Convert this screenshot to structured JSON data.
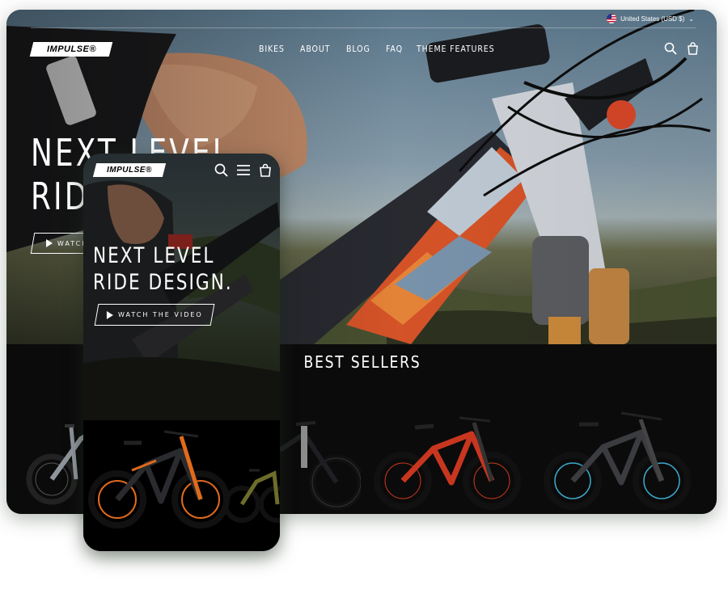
{
  "desktop": {
    "currency": "United States (USD $)",
    "logo": "IMPULSE®",
    "nav": [
      "BIKES",
      "ABOUT",
      "BLOG",
      "FAQ",
      "THEME FEATURES"
    ],
    "hero_line1": "NEXT LEVEL",
    "hero_line2": "RIDE",
    "watch_label": "WATCH",
    "section_title": "BEST SELLERS"
  },
  "mobile": {
    "logo": "IMPULSE®",
    "hero_line1": "NEXT LEVEL",
    "hero_line2": "RIDE DESIGN.",
    "watch_label": "WATCH THE VIDEO"
  },
  "products": [
    {
      "name": "grey-bike",
      "frame_color": "#8e949c"
    },
    {
      "name": "black-bike",
      "frame_color": "#1e1f22"
    },
    {
      "name": "red-bike",
      "frame_color": "#c8361f"
    },
    {
      "name": "dark-grey-bike",
      "frame_color": "#3a3c40"
    },
    {
      "name": "orange-bike",
      "frame_color": "#e06a1c"
    },
    {
      "name": "olive-bike",
      "frame_color": "#6b6d2a"
    }
  ],
  "icons": [
    "flag-icon",
    "chevron-down-icon",
    "search-icon",
    "cart-icon",
    "menu-icon",
    "play-icon"
  ],
  "colors": {
    "accent": "#ffffff",
    "background": "#000000"
  }
}
